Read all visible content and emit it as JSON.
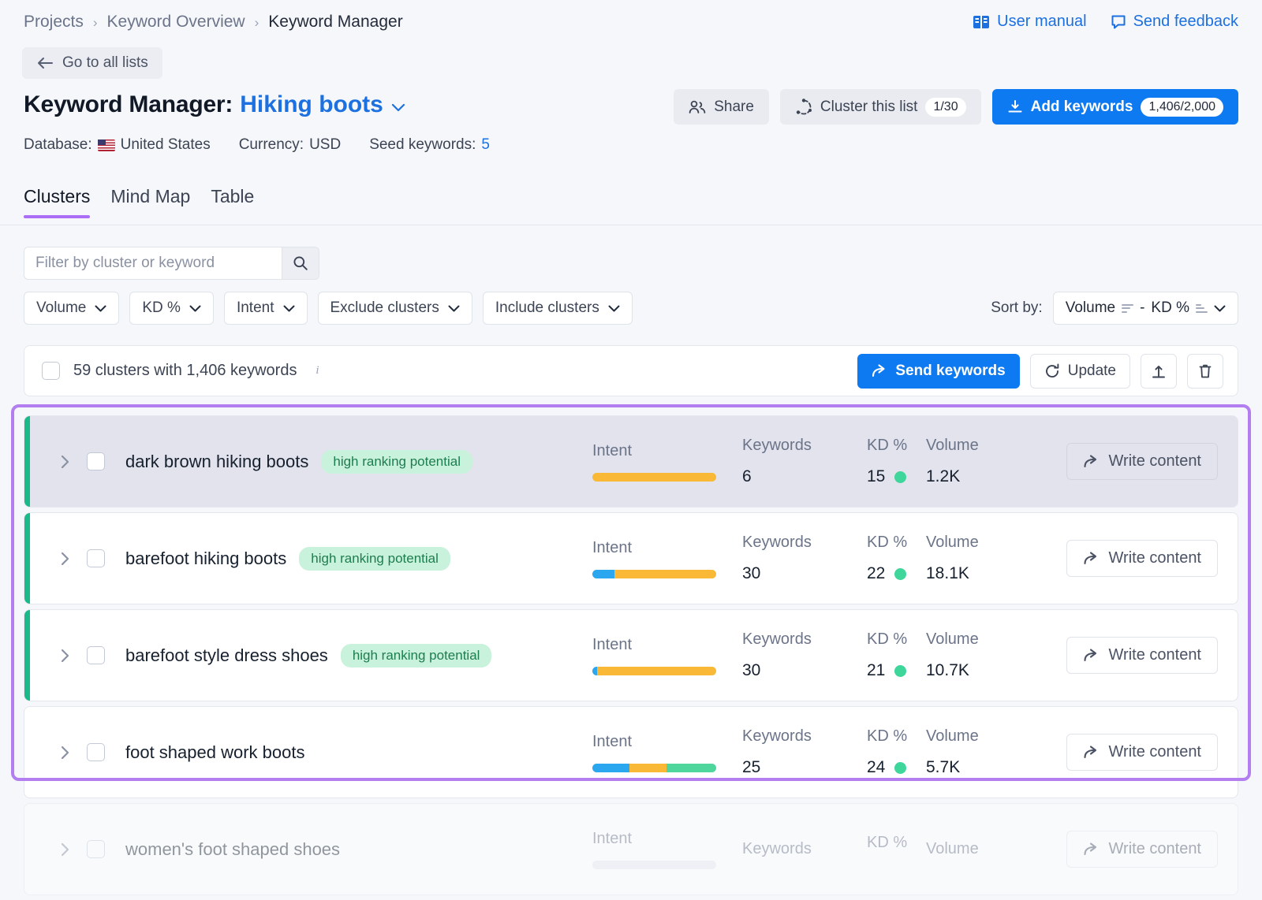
{
  "breadcrumb": {
    "items": [
      "Projects",
      "Keyword Overview",
      "Keyword Manager"
    ],
    "separator": "›"
  },
  "top_links": [
    {
      "label": "User manual",
      "icon": "book-icon"
    },
    {
      "label": "Send feedback",
      "icon": "speech-bubble-icon"
    }
  ],
  "back_button": {
    "label": "Go to all lists",
    "icon": "arrow-left-icon"
  },
  "title": {
    "prefix": "Keyword Manager:",
    "list_name": "Hiking boots",
    "caret": "⌄"
  },
  "meta": {
    "database_label": "Database:",
    "database_value": "United States",
    "currency_label": "Currency:",
    "currency_value": "USD",
    "seed_label": "Seed keywords:",
    "seed_value": "5"
  },
  "header_actions": {
    "share": "Share",
    "cluster_list": "Cluster this list",
    "cluster_list_count": "1/30",
    "add_keywords": "Add keywords",
    "add_keywords_count": "1,406/2,000"
  },
  "tabs": [
    {
      "label": "Clusters",
      "active": true
    },
    {
      "label": "Mind Map",
      "active": false
    },
    {
      "label": "Table",
      "active": false
    }
  ],
  "search": {
    "placeholder": "Filter by cluster or keyword",
    "value": ""
  },
  "filters": [
    "Volume",
    "KD %",
    "Intent",
    "Exclude clusters",
    "Include clusters"
  ],
  "sort": {
    "label": "Sort by:",
    "primary": "Volume",
    "separator": "-",
    "secondary": "KD %"
  },
  "toolbar": {
    "summary": "59 clusters with 1,406 keywords",
    "send_keywords": "Send keywords",
    "update": "Update",
    "export_icon": "upload-icon",
    "delete_icon": "trash-icon"
  },
  "columns": {
    "intent": "Intent",
    "keywords": "Keywords",
    "kd": "KD %",
    "volume": "Volume"
  },
  "write_content_label": "Write content",
  "colors": {
    "accent_blue": "#0e7af2",
    "highlight_purple": "#b37ef0",
    "tab_underline": "#ab6ef5",
    "cluster_green": "#19b98a",
    "badge_bg": "#c9f2dc",
    "badge_text": "#1d7d4f",
    "kd_dot_green": "#3fd69b",
    "intent_informational": "#2ba7ef",
    "intent_commercial": "#f9b937",
    "intent_transactional": "#4fd69c"
  },
  "rows": [
    {
      "name": "dark brown hiking boots",
      "badge": "high ranking potential",
      "selected": true,
      "green_bar": true,
      "intent_segments": [
        {
          "color": "#f9b937",
          "pct": 100
        }
      ],
      "keywords": "6",
      "kd": "15",
      "volume": "1.2K"
    },
    {
      "name": "barefoot hiking boots",
      "badge": "high ranking potential",
      "selected": false,
      "green_bar": true,
      "intent_segments": [
        {
          "color": "#2ba7ef",
          "pct": 18
        },
        {
          "color": "#f9b937",
          "pct": 82
        }
      ],
      "keywords": "30",
      "kd": "22",
      "volume": "18.1K"
    },
    {
      "name": "barefoot style dress shoes",
      "badge": "high ranking potential",
      "selected": false,
      "green_bar": true,
      "intent_segments": [
        {
          "color": "#2ba7ef",
          "pct": 4
        },
        {
          "color": "#f9b937",
          "pct": 96
        }
      ],
      "keywords": "30",
      "kd": "21",
      "volume": "10.7K"
    },
    {
      "name": "foot shaped work boots",
      "badge": "",
      "selected": false,
      "green_bar": false,
      "intent_segments": [
        {
          "color": "#2ba7ef",
          "pct": 30
        },
        {
          "color": "#f9b937",
          "pct": 30
        },
        {
          "color": "#4fd69c",
          "pct": 40
        }
      ],
      "keywords": "25",
      "kd": "24",
      "volume": "5.7K"
    },
    {
      "name": "women's foot shaped shoes",
      "badge": "",
      "selected": false,
      "green_bar": false,
      "intent_segments": [],
      "keywords": "",
      "kd": "",
      "volume": "",
      "partial": true
    }
  ]
}
